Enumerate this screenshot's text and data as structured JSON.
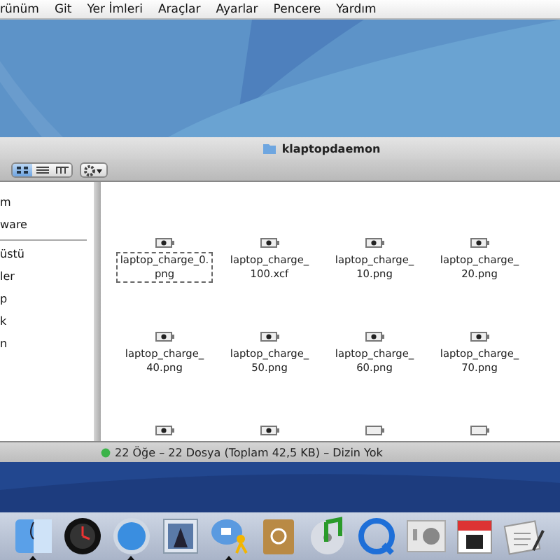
{
  "menu_bar": [
    "rünüm",
    "Git",
    "Yer İmleri",
    "Araçlar",
    "Ayarlar",
    "Pencere",
    "Yardım"
  ],
  "window": {
    "title": "klaptopdaemon"
  },
  "view_buttons": [
    {
      "selected": true
    },
    {
      "selected": false
    },
    {
      "selected": false
    }
  ],
  "sidebar": {
    "sections": [
      [
        "m",
        "ware"
      ],
      [
        "üstü",
        "ler",
        "p",
        "k",
        "n"
      ]
    ]
  },
  "files": [
    {
      "name": "laptop_charge_0.\npng",
      "selected": true
    },
    {
      "name": "laptop_charge_\n100.xcf",
      "selected": false
    },
    {
      "name": "laptop_charge_\n10.png",
      "selected": false
    },
    {
      "name": "laptop_charge_\n20.png",
      "selected": false
    },
    {
      "name": "laptop_charge_\n40.png",
      "selected": false
    },
    {
      "name": "laptop_charge_\n50.png",
      "selected": false
    },
    {
      "name": "laptop_charge_\n60.png",
      "selected": false
    },
    {
      "name": "laptop_charge_\n70.png",
      "selected": false
    }
  ],
  "status_bar": "22 Öğe – 22 Dosya (Toplam 42,5 KB) – Dizin Yok",
  "dock": [
    {
      "running": true
    },
    {
      "running": false
    },
    {
      "running": true
    },
    {
      "running": false
    },
    {
      "running": true
    },
    {
      "running": false
    },
    {
      "running": false
    },
    {
      "running": false
    },
    {
      "running": false
    },
    {
      "running": false
    },
    {
      "running": false
    }
  ]
}
